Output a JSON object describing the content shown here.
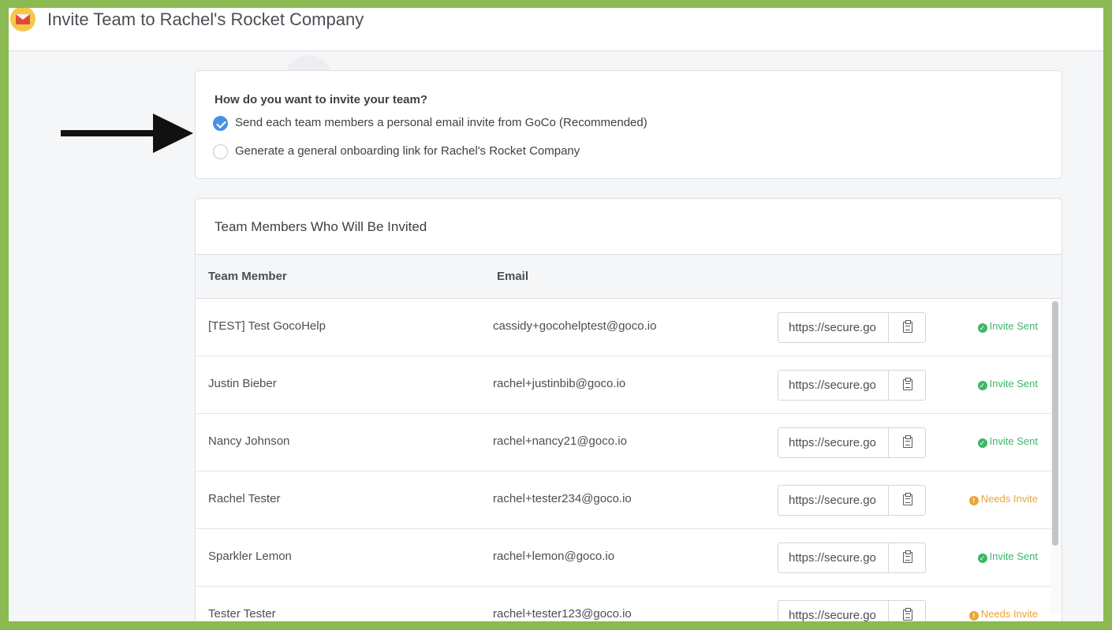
{
  "header": {
    "title": "Invite Team to Rachel's Rocket Company",
    "icon": "envelope-icon"
  },
  "invite_options": {
    "question": "How do you want to invite your team?",
    "options": [
      {
        "label": "Send each team members a personal email invite from GoCo (Recommended)",
        "checked": true
      },
      {
        "label": "Generate a general onboarding link for Rachel's Rocket Company",
        "checked": false
      }
    ]
  },
  "team": {
    "title": "Team Members Who Will Be Invited",
    "columns": {
      "member": "Team Member",
      "email": "Email"
    },
    "rows": [
      {
        "name": "[TEST] Test GocoHelp",
        "email": "cassidy+gocohelptest@goco.io",
        "link": "https://secure.go",
        "status": "Invite Sent",
        "status_type": "sent"
      },
      {
        "name": "Justin Bieber",
        "email": "rachel+justinbib@goco.io",
        "link": "https://secure.go",
        "status": "Invite Sent",
        "status_type": "sent"
      },
      {
        "name": "Nancy Johnson",
        "email": "rachel+nancy21@goco.io",
        "link": "https://secure.go",
        "status": "Invite Sent",
        "status_type": "sent"
      },
      {
        "name": "Rachel Tester",
        "email": "rachel+tester234@goco.io",
        "link": "https://secure.go",
        "status": "Needs Invite",
        "status_type": "needs"
      },
      {
        "name": "Sparkler Lemon",
        "email": "rachel+lemon@goco.io",
        "link": "https://secure.go",
        "status": "Invite Sent",
        "status_type": "sent"
      },
      {
        "name": "Tester Tester",
        "email": "rachel+tester123@goco.io",
        "link": "https://secure.go",
        "status": "Needs Invite",
        "status_type": "needs"
      }
    ]
  },
  "colors": {
    "frame": "#8bba52",
    "checked": "#4a90e2",
    "sent": "#3db66a",
    "needs": "#e9a43a"
  }
}
